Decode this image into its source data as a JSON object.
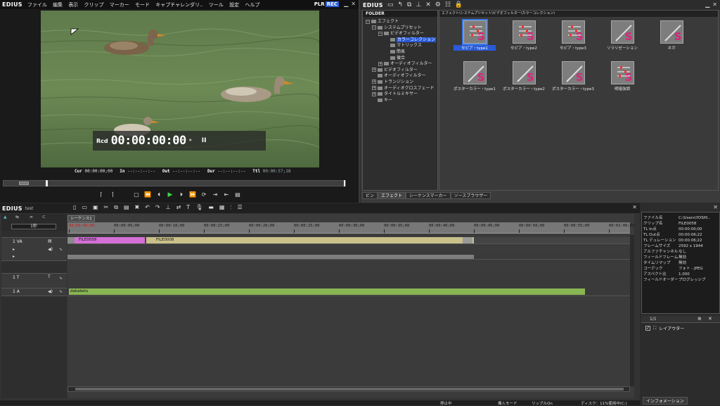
{
  "player": {
    "logo": "EDIUS",
    "menu": [
      "ファイル",
      "編集",
      "表示",
      "クリップ",
      "マーカー",
      "モード",
      "キャプチャレンダリ..",
      "ツール",
      "設定",
      "ヘルプ"
    ],
    "plr": "PLR",
    "rec": "REC",
    "tc_prefix": "Rcd",
    "timecode": "00:00:00:00",
    "tc_star": "*",
    "pause_glyph": "II",
    "cur_label": "Cur",
    "cur_val": "00:00:00;00",
    "in_label": "In",
    "in_val": "--:--:--:--",
    "out_label": "Out",
    "out_val": "--:--:--:--",
    "dur_label": "Dur",
    "dur_val": "--:--:--:--",
    "ttl_label": "Ttl",
    "ttl_val": "00:00:57;18"
  },
  "bin": {
    "logo": "EDIUS",
    "folder_header": "FOLDER",
    "path": "エフェクト\\システムプリセット\\ビデオフィルター\\カラーコレクション\\",
    "tree": [
      {
        "label": "エフェクト",
        "indent": 0,
        "box": "−"
      },
      {
        "label": "システムプリセット",
        "indent": 1,
        "box": "−"
      },
      {
        "label": "ビデオフィルター",
        "indent": 2,
        "box": "−"
      },
      {
        "label": "カラーコレクション",
        "indent": 3,
        "box": "",
        "sel": true
      },
      {
        "label": "マトリックス",
        "indent": 3,
        "box": ""
      },
      {
        "label": "簡易",
        "indent": 3,
        "box": ""
      },
      {
        "label": "複合",
        "indent": 3,
        "box": ""
      },
      {
        "label": "オーディオフィルター",
        "indent": 2,
        "box": "+"
      },
      {
        "label": "ビデオフィルター",
        "indent": 1,
        "box": "+"
      },
      {
        "label": "オーディオフィルター",
        "indent": 1,
        "box": ""
      },
      {
        "label": "トランジション",
        "indent": 1,
        "box": "+"
      },
      {
        "label": "オーディオクロスフェード",
        "indent": 1,
        "box": "+"
      },
      {
        "label": "タイトルミキサー",
        "indent": 1,
        "box": "+"
      },
      {
        "label": "キー",
        "indent": 1,
        "box": ""
      }
    ],
    "effects": [
      {
        "label": "セピア・type1",
        "sel": true
      },
      {
        "label": "セピア・type2"
      },
      {
        "label": "セピア・type3"
      },
      {
        "label": "ソラリゼーション"
      },
      {
        "label": "ネガ"
      },
      {
        "label": "ポスターカラー・type1"
      },
      {
        "label": "ポスターカラー・type2"
      },
      {
        "label": "ポスターカラー・type3"
      },
      {
        "label": "明暗強調"
      }
    ],
    "tabs": [
      "ビン",
      "エフェクト",
      "シーケンスマーカー",
      "ソースブラウザー"
    ]
  },
  "timeline": {
    "logo": "EDIUS",
    "project": "test",
    "sequence_tab": "シーケンス1",
    "mode_label": "1秒",
    "ruler": [
      "00:00:00;00",
      "00:00:05;00",
      "00:00:10;00",
      "00:00:15;00",
      "00:00:20;00",
      "00:00:25;00",
      "00:00:30;00",
      "00:00:35;00",
      "00:00:40;00",
      "00:00:45;00",
      "00:00:50;00",
      "00:00:55;00",
      "00:01:00;02"
    ],
    "tracks": {
      "va": "1 VA",
      "t": "1 T",
      "a": "1 A"
    },
    "clip1": "FILE0058",
    "clip2": "FILE0008",
    "audio_clip": "dakaketu",
    "status": [
      "停止中",
      "挿入モード",
      "リップルOn",
      "ディスク：11%使用中(C:)"
    ]
  },
  "info": {
    "rows": [
      {
        "k": "ファイル名",
        "v": "C:\\Users\\YOSHI.."
      },
      {
        "k": "クリップ名",
        "v": "FILE0058"
      },
      {
        "k": "TL In点",
        "v": "00:00:00;00"
      },
      {
        "k": "TL Out点",
        "v": "00:00:06;22"
      },
      {
        "k": "TL デュレーション",
        "v": "00:00:06;22"
      },
      {
        "k": "フレームサイズ",
        "v": "2592 x 1944"
      },
      {
        "k": "アルファチャンネル",
        "v": "なし"
      },
      {
        "k": "フィールドフレーム",
        "v": "無効"
      },
      {
        "k": "タイムリマップ",
        "v": "無効"
      },
      {
        "k": "コーデック",
        "v": "フォト - JPEG"
      },
      {
        "k": "アスペクト比",
        "v": "1.000"
      },
      {
        "k": "フィールドオーダー",
        "v": "プログレッシブ"
      }
    ],
    "layer_count": "1/1",
    "layouter": "レイアウター",
    "tab": "インフォメーション"
  }
}
